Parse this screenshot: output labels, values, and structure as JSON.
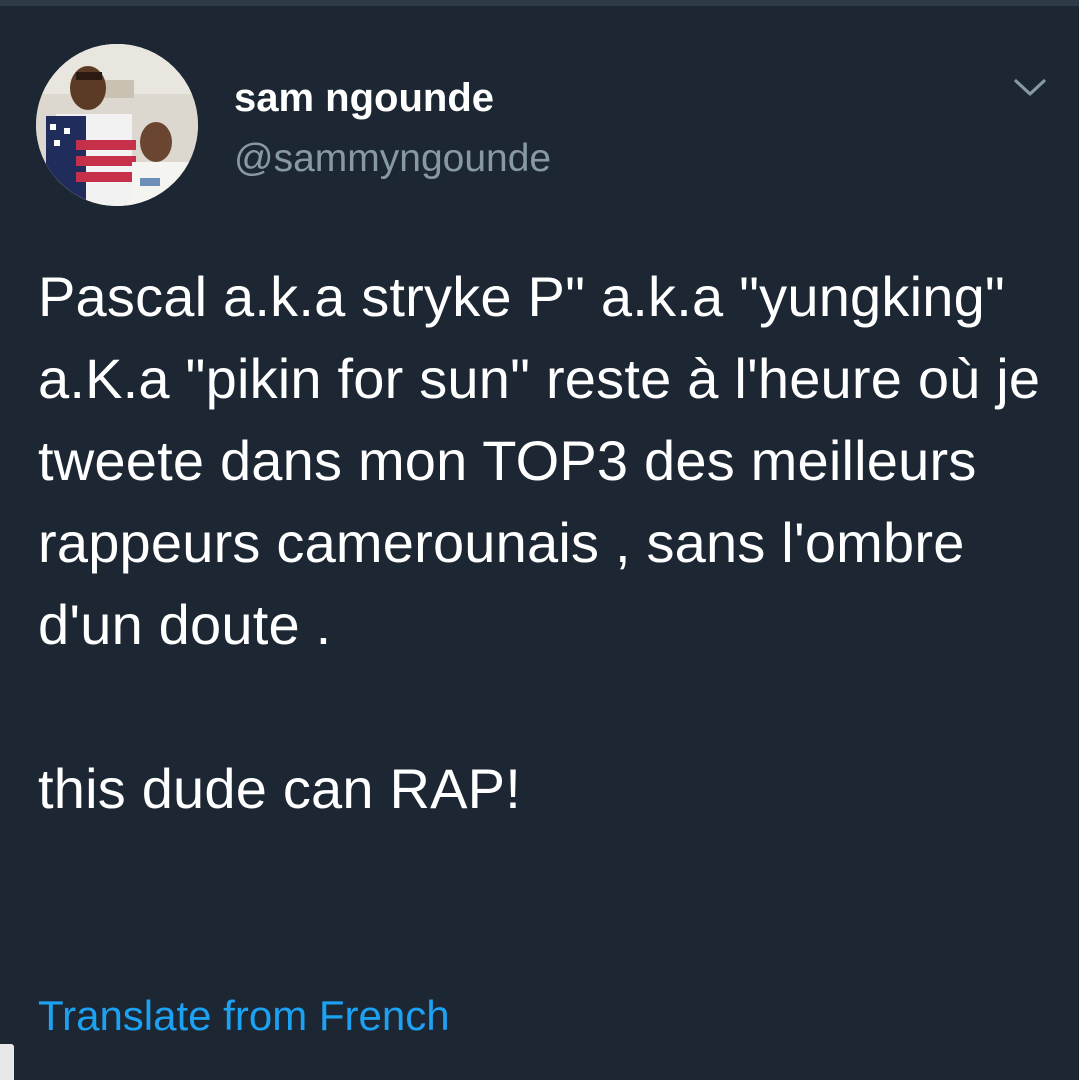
{
  "tweet": {
    "user": {
      "name": "sam ngounde",
      "handle": "@sammyngounde"
    },
    "text": "Pascal a.k.a stryke P\" a.k.a \"yungking\" a.K.a \"pikin for sun\" reste à l'heure où je tweete dans mon TOP3 des meilleurs rappeurs camerounais  , sans l'ombre d'un doute .\n\nthis dude can RAP!",
    "translate_label": "Translate from French"
  },
  "icons": {
    "menu": "chevron-down-icon",
    "avatar": "avatar"
  },
  "colors": {
    "background": "#1c2733",
    "text": "#ffffff",
    "secondary_text": "#8899a6",
    "link": "#1da1f2"
  }
}
